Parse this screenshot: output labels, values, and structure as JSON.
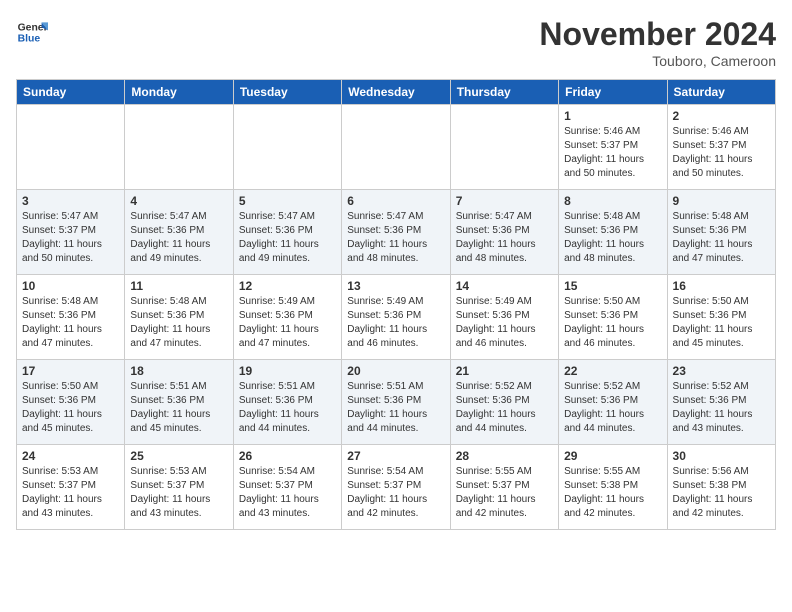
{
  "header": {
    "logo_general": "General",
    "logo_blue": "Blue",
    "month": "November 2024",
    "location": "Touboro, Cameroon"
  },
  "days_of_week": [
    "Sunday",
    "Monday",
    "Tuesday",
    "Wednesday",
    "Thursday",
    "Friday",
    "Saturday"
  ],
  "weeks": [
    [
      {
        "day": "",
        "info": ""
      },
      {
        "day": "",
        "info": ""
      },
      {
        "day": "",
        "info": ""
      },
      {
        "day": "",
        "info": ""
      },
      {
        "day": "",
        "info": ""
      },
      {
        "day": "1",
        "info": "Sunrise: 5:46 AM\nSunset: 5:37 PM\nDaylight: 11 hours\nand 50 minutes."
      },
      {
        "day": "2",
        "info": "Sunrise: 5:46 AM\nSunset: 5:37 PM\nDaylight: 11 hours\nand 50 minutes."
      }
    ],
    [
      {
        "day": "3",
        "info": "Sunrise: 5:47 AM\nSunset: 5:37 PM\nDaylight: 11 hours\nand 50 minutes."
      },
      {
        "day": "4",
        "info": "Sunrise: 5:47 AM\nSunset: 5:36 PM\nDaylight: 11 hours\nand 49 minutes."
      },
      {
        "day": "5",
        "info": "Sunrise: 5:47 AM\nSunset: 5:36 PM\nDaylight: 11 hours\nand 49 minutes."
      },
      {
        "day": "6",
        "info": "Sunrise: 5:47 AM\nSunset: 5:36 PM\nDaylight: 11 hours\nand 48 minutes."
      },
      {
        "day": "7",
        "info": "Sunrise: 5:47 AM\nSunset: 5:36 PM\nDaylight: 11 hours\nand 48 minutes."
      },
      {
        "day": "8",
        "info": "Sunrise: 5:48 AM\nSunset: 5:36 PM\nDaylight: 11 hours\nand 48 minutes."
      },
      {
        "day": "9",
        "info": "Sunrise: 5:48 AM\nSunset: 5:36 PM\nDaylight: 11 hours\nand 47 minutes."
      }
    ],
    [
      {
        "day": "10",
        "info": "Sunrise: 5:48 AM\nSunset: 5:36 PM\nDaylight: 11 hours\nand 47 minutes."
      },
      {
        "day": "11",
        "info": "Sunrise: 5:48 AM\nSunset: 5:36 PM\nDaylight: 11 hours\nand 47 minutes."
      },
      {
        "day": "12",
        "info": "Sunrise: 5:49 AM\nSunset: 5:36 PM\nDaylight: 11 hours\nand 47 minutes."
      },
      {
        "day": "13",
        "info": "Sunrise: 5:49 AM\nSunset: 5:36 PM\nDaylight: 11 hours\nand 46 minutes."
      },
      {
        "day": "14",
        "info": "Sunrise: 5:49 AM\nSunset: 5:36 PM\nDaylight: 11 hours\nand 46 minutes."
      },
      {
        "day": "15",
        "info": "Sunrise: 5:50 AM\nSunset: 5:36 PM\nDaylight: 11 hours\nand 46 minutes."
      },
      {
        "day": "16",
        "info": "Sunrise: 5:50 AM\nSunset: 5:36 PM\nDaylight: 11 hours\nand 45 minutes."
      }
    ],
    [
      {
        "day": "17",
        "info": "Sunrise: 5:50 AM\nSunset: 5:36 PM\nDaylight: 11 hours\nand 45 minutes."
      },
      {
        "day": "18",
        "info": "Sunrise: 5:51 AM\nSunset: 5:36 PM\nDaylight: 11 hours\nand 45 minutes."
      },
      {
        "day": "19",
        "info": "Sunrise: 5:51 AM\nSunset: 5:36 PM\nDaylight: 11 hours\nand 44 minutes."
      },
      {
        "day": "20",
        "info": "Sunrise: 5:51 AM\nSunset: 5:36 PM\nDaylight: 11 hours\nand 44 minutes."
      },
      {
        "day": "21",
        "info": "Sunrise: 5:52 AM\nSunset: 5:36 PM\nDaylight: 11 hours\nand 44 minutes."
      },
      {
        "day": "22",
        "info": "Sunrise: 5:52 AM\nSunset: 5:36 PM\nDaylight: 11 hours\nand 44 minutes."
      },
      {
        "day": "23",
        "info": "Sunrise: 5:52 AM\nSunset: 5:36 PM\nDaylight: 11 hours\nand 43 minutes."
      }
    ],
    [
      {
        "day": "24",
        "info": "Sunrise: 5:53 AM\nSunset: 5:37 PM\nDaylight: 11 hours\nand 43 minutes."
      },
      {
        "day": "25",
        "info": "Sunrise: 5:53 AM\nSunset: 5:37 PM\nDaylight: 11 hours\nand 43 minutes."
      },
      {
        "day": "26",
        "info": "Sunrise: 5:54 AM\nSunset: 5:37 PM\nDaylight: 11 hours\nand 43 minutes."
      },
      {
        "day": "27",
        "info": "Sunrise: 5:54 AM\nSunset: 5:37 PM\nDaylight: 11 hours\nand 42 minutes."
      },
      {
        "day": "28",
        "info": "Sunrise: 5:55 AM\nSunset: 5:37 PM\nDaylight: 11 hours\nand 42 minutes."
      },
      {
        "day": "29",
        "info": "Sunrise: 5:55 AM\nSunset: 5:38 PM\nDaylight: 11 hours\nand 42 minutes."
      },
      {
        "day": "30",
        "info": "Sunrise: 5:56 AM\nSunset: 5:38 PM\nDaylight: 11 hours\nand 42 minutes."
      }
    ]
  ]
}
